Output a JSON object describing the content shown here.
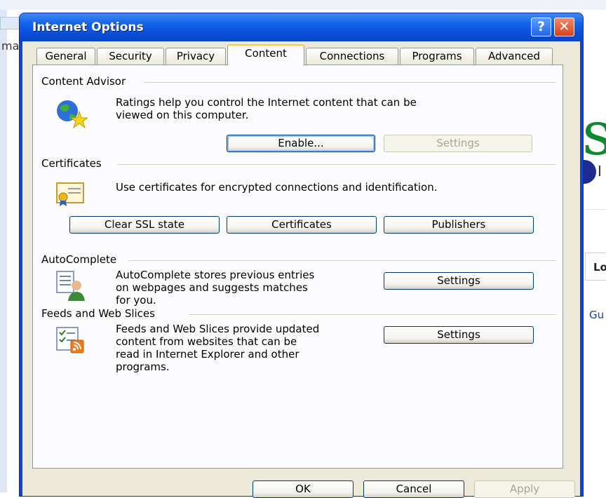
{
  "background": {
    "left_snip": "ma",
    "right_letter": "s",
    "right_i": "I",
    "right_lo": "Lo",
    "right_gu": "Gu"
  },
  "window": {
    "title": "Internet Options",
    "help_glyph": "?",
    "close_glyph": "✕"
  },
  "tabs": [
    {
      "label": "General",
      "active": false
    },
    {
      "label": "Security",
      "active": false
    },
    {
      "label": "Privacy",
      "active": false
    },
    {
      "label": "Content",
      "active": true
    },
    {
      "label": "Connections",
      "active": false
    },
    {
      "label": "Programs",
      "active": false
    },
    {
      "label": "Advanced",
      "active": false
    }
  ],
  "content_advisor": {
    "heading": "Content Advisor",
    "description_line1": "Ratings help you control the Internet content that can be",
    "description_line2": "viewed on this computer.",
    "enable_label": "Enable...",
    "settings_label": "Settings",
    "icon": "globe-star-icon"
  },
  "certificates": {
    "heading": "Certificates",
    "description": "Use certificates for encrypted connections and identification.",
    "clear_ssl_label": "Clear SSL state",
    "certificates_label": "Certificates",
    "publishers_label": "Publishers",
    "icon": "certificate-icon"
  },
  "autocomplete": {
    "heading": "AutoComplete",
    "description_line1": "AutoComplete stores previous entries",
    "description_line2": "on webpages and suggests matches",
    "description_line3": "for you.",
    "settings_label": "Settings",
    "icon": "autocomplete-user-icon"
  },
  "feeds": {
    "heading": "Feeds and Web Slices",
    "description_line1": "Feeds and Web Slices provide updated",
    "description_line2": "content from websites that can be",
    "description_line3": "read in Internet Explorer and other",
    "description_line4": "programs.",
    "settings_label": "Settings",
    "icon": "feed-icon"
  },
  "footer": {
    "ok_label": "OK",
    "cancel_label": "Cancel",
    "apply_label": "Apply"
  },
  "colors": {
    "titlebar": "#0a4fd8",
    "dialog_bg": "#ece9d8",
    "panel_bg": "#fcfcfe",
    "active_tab_accent": "#ffc73c"
  }
}
